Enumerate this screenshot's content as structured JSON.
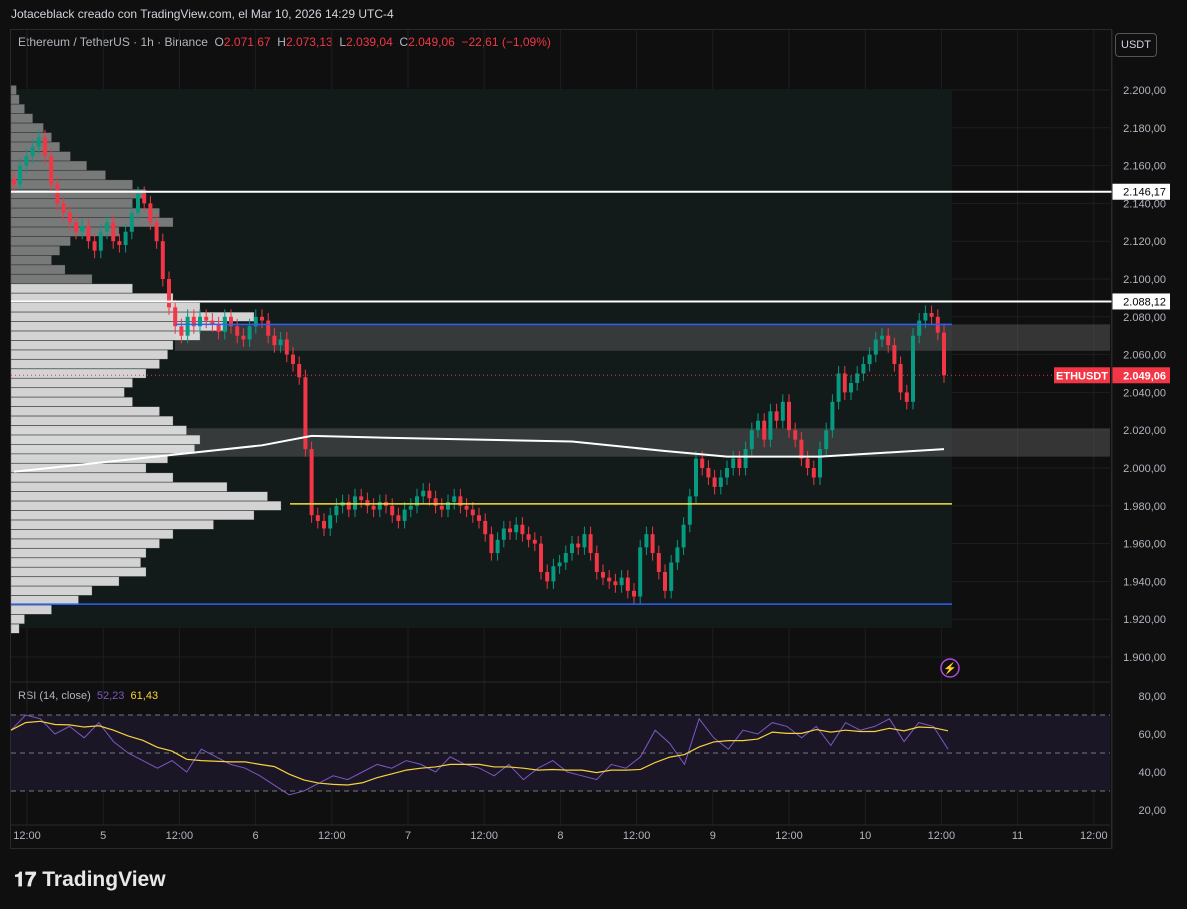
{
  "header": {
    "credit": "Jotaceblack creado con TradingView.com, el Mar 10, 2026 14:29 UTC-4"
  },
  "legend": {
    "symbol": "Ethereum / TetherUS · 1h · Binance",
    "o_label": "O",
    "o": "2.071,67",
    "h_label": "H",
    "h": "2.073,13",
    "l_label": "L",
    "l": "2.039,04",
    "c_label": "C",
    "c": "2.049,06",
    "change": "−22,61 (−1,09%)"
  },
  "currency_button": "USDT",
  "brand": "TradingView",
  "colors": {
    "up": "#089981",
    "down": "#f23645",
    "rsi": "#7e57c2",
    "rsi_ma": "#f7d23c",
    "level": "#ffffff",
    "blue": "#2962ff",
    "yellow": "#f7e23c"
  },
  "chart_data": {
    "type": "candlestick",
    "title": "Ethereum / TetherUS · 1h · Binance",
    "ylim": [
      1890,
      2210
    ],
    "y_ticks": [
      "2.200,00",
      "2.180,00",
      "2.160,00",
      "2.140,00",
      "2.120,00",
      "2.100,00",
      "2.080,00",
      "2.060,00",
      "2.040,00",
      "2.020,00",
      "2.000,00",
      "1.980,00",
      "1.960,00",
      "1.940,00",
      "1.920,00",
      "1.900,00"
    ],
    "y_tick_values": [
      2200,
      2180,
      2160,
      2140,
      2120,
      2100,
      2080,
      2060,
      2040,
      2020,
      2000,
      1980,
      1960,
      1940,
      1920,
      1900
    ],
    "x_ticks": [
      "12:00",
      "5",
      "12:00",
      "6",
      "12:00",
      "7",
      "12:00",
      "8",
      "12:00",
      "9",
      "12:00",
      "10",
      "12:00",
      "11",
      "12:00"
    ],
    "closes": [
      2150,
      2160,
      2165,
      2170,
      2175,
      2165,
      2150,
      2140,
      2135,
      2130,
      2125,
      2128,
      2120,
      2115,
      2125,
      2130,
      2120,
      2118,
      2125,
      2135,
      2145,
      2140,
      2130,
      2120,
      2100,
      2085,
      2075,
      2070,
      2080,
      2075,
      2080,
      2078,
      2076,
      2072,
      2080,
      2075,
      2070,
      2068,
      2075,
      2080,
      2078,
      2070,
      2065,
      2068,
      2060,
      2055,
      2048,
      2010,
      1975,
      1972,
      1968,
      1975,
      1980,
      1982,
      1978,
      1985,
      1983,
      1980,
      1978,
      1982,
      1980,
      1975,
      1972,
      1978,
      1980,
      1985,
      1988,
      1984,
      1980,
      1978,
      1982,
      1985,
      1980,
      1978,
      1975,
      1972,
      1965,
      1955,
      1962,
      1968,
      1966,
      1970,
      1965,
      1962,
      1960,
      1945,
      1940,
      1948,
      1950,
      1955,
      1960,
      1958,
      1965,
      1955,
      1945,
      1942,
      1940,
      1938,
      1942,
      1935,
      1932,
      1958,
      1965,
      1955,
      1945,
      1935,
      1950,
      1958,
      1970,
      1985,
      2005,
      2000,
      1995,
      1990,
      1995,
      2000,
      2005,
      2000,
      2010,
      2020,
      2025,
      2015,
      2030,
      2025,
      2035,
      2020,
      2015,
      2005,
      2000,
      1995,
      2010,
      2020,
      2035,
      2050,
      2040,
      2045,
      2050,
      2055,
      2060,
      2068,
      2070,
      2065,
      2055,
      2040,
      2035,
      2070,
      2078,
      2082,
      2080,
      2071.67,
      2049.06
    ],
    "moving_average": [
      [
        0,
        1998
      ],
      [
        20,
        2005
      ],
      [
        40,
        2012
      ],
      [
        48,
        2017
      ],
      [
        60,
        2016
      ],
      [
        90,
        2014
      ],
      [
        105,
        2009
      ],
      [
        115,
        2006
      ],
      [
        130,
        2006
      ],
      [
        140,
        2008
      ],
      [
        150,
        2010
      ]
    ],
    "volume_profile_start": 2200,
    "volume_profile_step": 5,
    "volume_profile": [
      0.02,
      0.03,
      0.05,
      0.08,
      0.12,
      0.15,
      0.18,
      0.22,
      0.28,
      0.35,
      0.45,
      0.5,
      0.45,
      0.55,
      0.6,
      0.4,
      0.22,
      0.18,
      0.15,
      0.2,
      0.3,
      0.45,
      0.6,
      0.7,
      0.9,
      0.8,
      0.7,
      0.6,
      0.58,
      0.55,
      0.5,
      0.45,
      0.42,
      0.45,
      0.55,
      0.6,
      0.65,
      0.7,
      0.68,
      0.58,
      0.5,
      0.6,
      0.8,
      0.95,
      1.0,
      0.9,
      0.75,
      0.6,
      0.55,
      0.5,
      0.48,
      0.5,
      0.4,
      0.3,
      0.25,
      0.15,
      0.05,
      0.03
    ],
    "levels": [
      {
        "price": 2146.17,
        "label": "2.146,17"
      },
      {
        "price": 2088.12,
        "label": "2.088,12"
      }
    ],
    "blue_lines": [
      2076,
      1928
    ],
    "yellow_line": 1981,
    "zones": [
      [
        2062,
        2076
      ],
      [
        2006,
        2021
      ]
    ],
    "last_price": {
      "symbol": "ETHUSDT",
      "label": "2.049,06",
      "value": 2049.06
    },
    "rsi": {
      "label": "RSI (14, close)",
      "value": "52,23",
      "ma_value": "61,43",
      "ylim": [
        20,
        80
      ],
      "ticks": [
        "80,00",
        "60,00",
        "40,00",
        "20,00"
      ],
      "tick_values": [
        80,
        60,
        40,
        20
      ],
      "bands": [
        70,
        50,
        30
      ],
      "values": [
        62,
        70,
        68,
        60,
        64,
        58,
        66,
        56,
        50,
        46,
        42,
        46,
        40,
        52,
        48,
        44,
        42,
        38,
        33,
        28,
        30,
        34,
        38,
        36,
        40,
        44,
        42,
        46,
        44,
        40,
        48,
        44,
        42,
        38,
        44,
        36,
        42,
        46,
        40,
        38,
        36,
        44,
        42,
        48,
        62,
        55,
        44,
        68,
        58,
        52,
        62,
        60,
        66,
        64,
        58,
        64,
        54,
        66,
        62,
        64,
        68,
        56,
        66,
        64,
        52
      ]
    }
  }
}
